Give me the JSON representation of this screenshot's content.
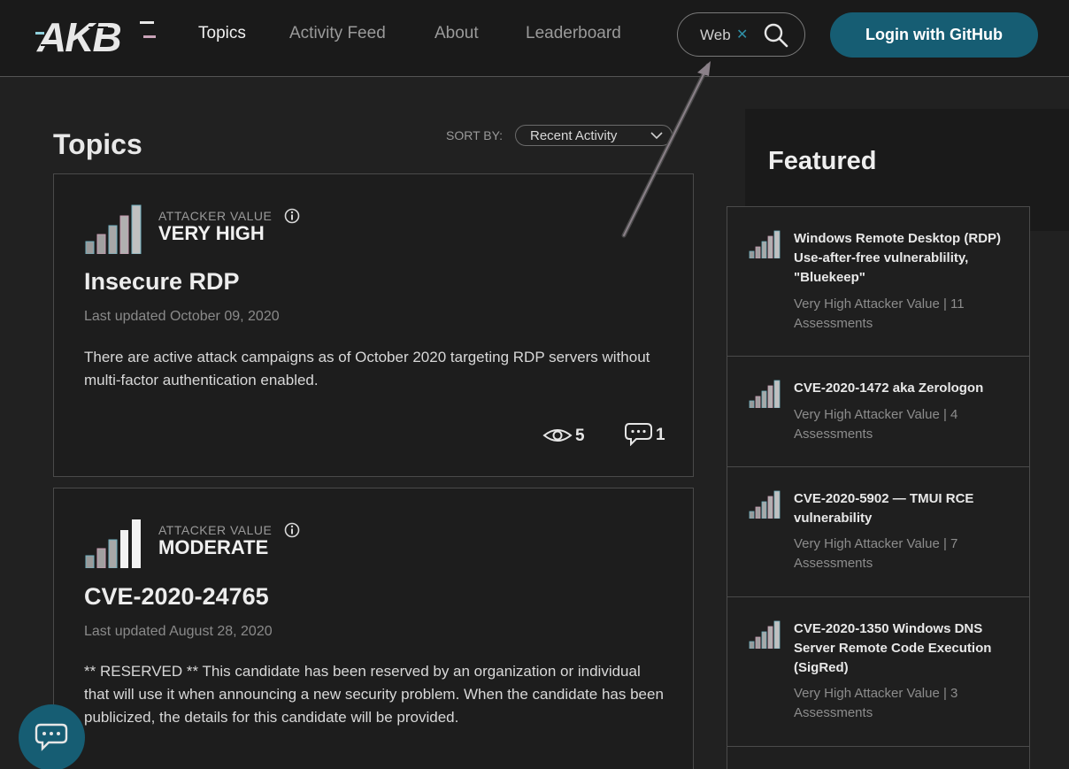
{
  "header": {
    "logo_text": "AKB",
    "nav": [
      {
        "label": "Topics",
        "active": true
      },
      {
        "label": "Activity Feed",
        "active": false
      },
      {
        "label": "About",
        "active": false
      },
      {
        "label": "Leaderboard",
        "active": false
      }
    ],
    "search": {
      "value": "Web"
    },
    "login_label": "Login with GitHub"
  },
  "main": {
    "title": "Topics",
    "sort": {
      "label": "SORT BY:",
      "selected": "Recent Activity"
    },
    "cards": [
      {
        "attacker_value_label": "ATTACKER VALUE",
        "attacker_value": "VERY HIGH",
        "title": "Insecure RDP",
        "updated": "Last updated October 09, 2020",
        "description": "There are active attack campaigns as of October 2020 targeting RDP servers without multi-factor authentication enabled.",
        "views": "5",
        "comments": "1"
      },
      {
        "attacker_value_label": "ATTACKER VALUE",
        "attacker_value": "MODERATE",
        "title": "CVE-2020-24765",
        "updated": "Last updated August 28, 2020",
        "description": "** RESERVED ** This candidate has been reserved by an organization or individual that will use it when announcing a new security problem. When the candidate has been publicized, the details for this candidate will be provided."
      }
    ]
  },
  "featured": {
    "title": "Featured",
    "items": [
      {
        "title": "Windows Remote Desktop (RDP) Use-after-free vulnerablility, \"Bluekeep\"",
        "meta": "Very High Attacker Value  |  11 Assessments"
      },
      {
        "title": "CVE-2020-1472 aka Zerologon",
        "meta": "Very High Attacker Value  |  4 Assessments"
      },
      {
        "title": "CVE-2020-5902 — TMUI RCE vulnerability",
        "meta": "Very High Attacker Value  |  7 Assessments"
      },
      {
        "title": "CVE-2020-1350 Windows DNS Server Remote Code Execution (SigRed)",
        "meta": "Very High Attacker Value  |  3 Assessments"
      }
    ]
  },
  "colors": {
    "accent": "#165d73",
    "background": "#212121",
    "header": "#1a1a1a"
  },
  "icons": [
    "search-icon",
    "close-icon",
    "info-icon",
    "eye-icon",
    "comment-icon",
    "chat-icon",
    "chevron-down-icon",
    "signal-bars-icon"
  ]
}
